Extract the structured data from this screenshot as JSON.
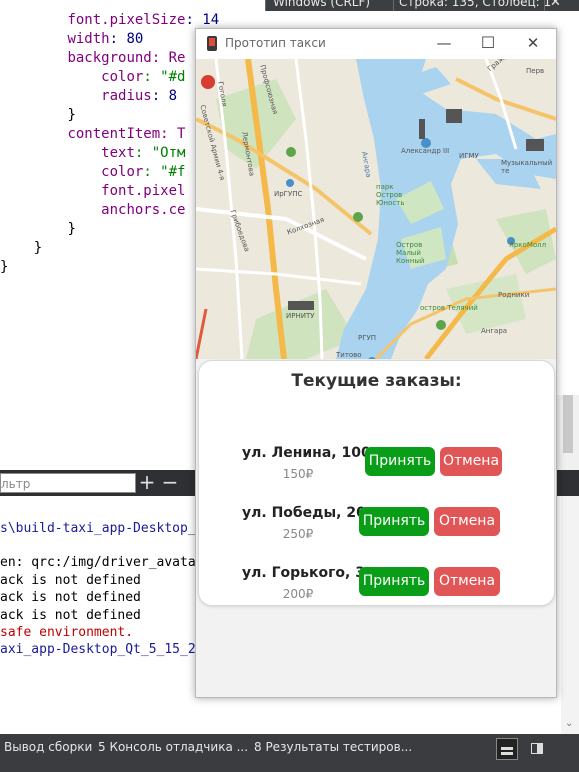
{
  "ide": {
    "status_top": {
      "encoding": "Windows (CRLF)",
      "position": "Строка: 135, Столбец: 1"
    },
    "code_lines": [
      {
        "indent": "        ",
        "key": "font.pixelSize",
        "rest": ": 14"
      },
      {
        "indent": "        ",
        "key": "width",
        "rest": ": 80"
      },
      {
        "indent": "        ",
        "key": "background",
        "rest": ": Re"
      },
      {
        "indent": "            ",
        "key": "color",
        "rest": ": \"#d"
      },
      {
        "indent": "            ",
        "key": "radius",
        "rest": ": 8"
      },
      {
        "indent": "        ",
        "key": "}",
        "rest": ""
      },
      {
        "indent": "        ",
        "key": "contentItem",
        "rest": ": T"
      },
      {
        "indent": "            ",
        "key": "text",
        "rest": ": \"Отм"
      },
      {
        "indent": "            ",
        "key": "color",
        "rest": ": \"#f"
      },
      {
        "indent": "            ",
        "key": "font.pixel",
        "rest": ""
      },
      {
        "indent": "            ",
        "key": "anchors.ce",
        "rest": ""
      },
      {
        "indent": "        ",
        "key": "}",
        "rest": ""
      },
      {
        "indent": "    ",
        "key": "}",
        "rest": ""
      },
      {
        "indent": "",
        "key": "}",
        "rest": ""
      }
    ],
    "filter_placeholder": "льтр",
    "filter_add": "+",
    "filter_remove": "−",
    "output_lines": [
      {
        "text": "s\\build-taxi_app-Desktop_",
        "style": "link"
      },
      {
        "text": "",
        "style": "plain"
      },
      {
        "text": "en: qrc:/img/driver_avata",
        "style": "plain"
      },
      {
        "text": "ack is not defined",
        "style": "plain"
      },
      {
        "text": "ack is not defined",
        "style": "plain"
      },
      {
        "text": "ack is not defined",
        "style": "plain"
      },
      {
        "text": "safe environment.",
        "style": "red"
      },
      {
        "text": "axi_app-Desktop_Qt_5_15_2",
        "style": "link"
      }
    ],
    "bottom_tabs": [
      {
        "label": "Вывод сборки"
      },
      {
        "label": "5  Консоль отладчика ..."
      },
      {
        "label": "8  Результаты тестиров..."
      }
    ]
  },
  "app": {
    "window_title": "Прототип такси",
    "controls": {
      "minimize": "—",
      "maximize": "☐",
      "close": "✕"
    },
    "map": {
      "labels": {
        "gogolya": "Гоголя",
        "profsoyuznaya": "Профсоюзная",
        "lermontova": "Лермонтова",
        "sovetskoy_armii": "Советской Армии 4-я",
        "aleksandr_iii": "Александр III",
        "igmu": "ИГМУ",
        "muz_teatr": "Музыкальный те",
        "angara_river": "Ангара",
        "park_ostrov": "парк Остров Юность",
        "igups": "ИрГУПС",
        "kolkhoznaya": "Колхозная",
        "griboedova": "Грибоедова",
        "ostrov_maly": "Остров Малый Конный",
        "yarkomoll": "ЯркоМолл",
        "rodniki": "Родники",
        "ostrov_telyachiy": "остров Телячий",
        "irnitu": "ИРНИТУ",
        "angara_dist": "Ангара",
        "rgup": "РГУП",
        "titova": "Титово",
        "grazhdanskaya": "Гражданская",
        "perv": "Перв"
      }
    },
    "panel": {
      "heading": "Текущие заказы:",
      "orders": [
        {
          "address": "ул. Ленина, 100",
          "price": "150₽",
          "accept": "Принять",
          "cancel": "Отмена"
        },
        {
          "address": "ул. Победы, 20",
          "price": "250₽",
          "accept": "Принять",
          "cancel": "Отмена"
        },
        {
          "address": "ул. Горького, 3",
          "price": "200₽",
          "accept": "Принять",
          "cancel": "Отмена"
        }
      ]
    }
  }
}
